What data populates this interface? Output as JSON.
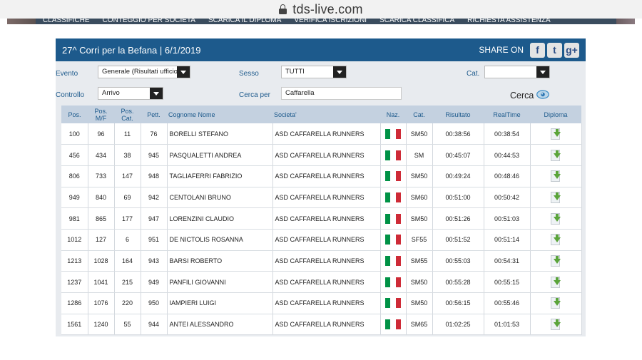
{
  "browser": {
    "url": "tds-live.com"
  },
  "site_nav": {
    "items": [
      "CLASSIFICHE",
      "CONTEGGIO PER SOCIETA",
      "SCARICA IL DIPLOMA",
      "VERIFICA ISCRIZIONI",
      "SCARICA CLASSIFICA",
      "RICHIESTA ASSISTENZA"
    ]
  },
  "header": {
    "title": "27^ Corri per la Befana  |  6/1/2019",
    "share_label": "SHARE ON"
  },
  "social": {
    "facebook": "f",
    "twitter": "t",
    "googleplus": "g+"
  },
  "filters": {
    "evento_label": "Evento",
    "evento_value": "Generale (Risultati ufficiosi)",
    "sesso_label": "Sesso",
    "sesso_value": "TUTTI",
    "cat_label": "Cat.",
    "cat_value": "",
    "controllo_label": "Controllo",
    "controllo_value": "Arrivo",
    "cerca_per_label": "Cerca per",
    "cerca_per_value": "Caffarella",
    "cerca_button": "Cerca"
  },
  "table": {
    "headers": [
      "Pos.",
      "Pos. M/F",
      "Pos. Cat.",
      "Pett.",
      "Cognome Nome",
      "Societa'",
      "Naz.",
      "Cat.",
      "Risultato",
      "RealTime",
      "Diploma"
    ],
    "rows": [
      {
        "pos": "100",
        "pos_mf": "96",
        "pos_cat": "11",
        "pett": "76",
        "name": "BORELLI STEFANO",
        "societa": "ASD CAFFARELLA RUNNERS",
        "naz": "italy-flag",
        "cat": "SM50",
        "risultato": "00:38:56",
        "realtime": "00:38:54"
      },
      {
        "pos": "456",
        "pos_mf": "434",
        "pos_cat": "38",
        "pett": "945",
        "name": "PASQUALETTI ANDREA",
        "societa": "ASD CAFFARELLA RUNNERS",
        "naz": "italy-flag",
        "cat": "SM",
        "risultato": "00:45:07",
        "realtime": "00:44:53"
      },
      {
        "pos": "806",
        "pos_mf": "733",
        "pos_cat": "147",
        "pett": "948",
        "name": "TAGLIAFERRI FABRIZIO",
        "societa": "ASD CAFFARELLA RUNNERS",
        "naz": "italy-flag",
        "cat": "SM50",
        "risultato": "00:49:24",
        "realtime": "00:48:46"
      },
      {
        "pos": "949",
        "pos_mf": "840",
        "pos_cat": "69",
        "pett": "942",
        "name": "CENTOLANI BRUNO",
        "societa": "ASD CAFFARELLA RUNNERS",
        "naz": "italy-flag",
        "cat": "SM60",
        "risultato": "00:51:00",
        "realtime": "00:50:42"
      },
      {
        "pos": "981",
        "pos_mf": "865",
        "pos_cat": "177",
        "pett": "947",
        "name": "LORENZINI CLAUDIO",
        "societa": "ASD CAFFARELLA RUNNERS",
        "naz": "italy-flag",
        "cat": "SM50",
        "risultato": "00:51:26",
        "realtime": "00:51:03"
      },
      {
        "pos": "1012",
        "pos_mf": "127",
        "pos_cat": "6",
        "pett": "951",
        "name": "DE NICTOLIS ROSANNA",
        "societa": "ASD CAFFARELLA RUNNERS",
        "naz": "italy-flag",
        "cat": "SF55",
        "risultato": "00:51:52",
        "realtime": "00:51:14"
      },
      {
        "pos": "1213",
        "pos_mf": "1028",
        "pos_cat": "164",
        "pett": "943",
        "name": "BARSI ROBERTO",
        "societa": "ASD CAFFARELLA RUNNERS",
        "naz": "italy-flag",
        "cat": "SM55",
        "risultato": "00:55:03",
        "realtime": "00:54:31"
      },
      {
        "pos": "1237",
        "pos_mf": "1041",
        "pos_cat": "215",
        "pett": "949",
        "name": "PANFILI GIOVANNI",
        "societa": "ASD CAFFARELLA RUNNERS",
        "naz": "italy-flag",
        "cat": "SM50",
        "risultato": "00:55:28",
        "realtime": "00:55:15"
      },
      {
        "pos": "1286",
        "pos_mf": "1076",
        "pos_cat": "220",
        "pett": "950",
        "name": "IAMPIERI LUIGI",
        "societa": "ASD CAFFARELLA RUNNERS",
        "naz": "italy-flag",
        "cat": "SM50",
        "risultato": "00:56:15",
        "realtime": "00:55:46"
      },
      {
        "pos": "1561",
        "pos_mf": "1240",
        "pos_cat": "55",
        "pett": "944",
        "name": "ANTEI ALESSANDRO",
        "societa": "ASD CAFFARELLA RUNNERS",
        "naz": "italy-flag",
        "cat": "SM65",
        "risultato": "01:02:25",
        "realtime": "01:01:53"
      }
    ]
  },
  "colors": {
    "header_bg": "#1d5a8c",
    "panel_bg": "#e8ebef",
    "table_header_bg": "#c4d1e0",
    "flag": [
      "#009246",
      "#ffffff",
      "#ce2b37"
    ],
    "download": "#5aa43a"
  }
}
